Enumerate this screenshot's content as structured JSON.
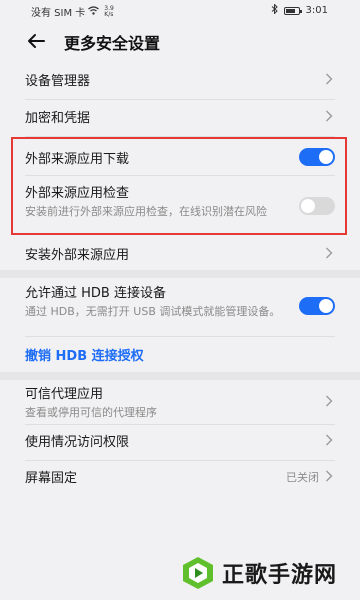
{
  "status_bar": {
    "carrier": "没有 SIM 卡",
    "net_speed_value": "3.9",
    "net_speed_unit": "K/s",
    "time": "3:01",
    "icons": [
      "wifi-icon",
      "bluetooth-icon",
      "battery-icon"
    ]
  },
  "header": {
    "title": "更多安全设置"
  },
  "items": {
    "device_admin": {
      "label": "设备管理器"
    },
    "encryption": {
      "label": "加密和凭据"
    },
    "ext_download": {
      "label": "外部来源应用下载",
      "enabled": true
    },
    "ext_check": {
      "label": "外部来源应用检查",
      "desc": "安装前进行外部来源应用检查，在线识别潜在风险",
      "enabled": false
    },
    "install_ext": {
      "label": "安装外部来源应用"
    },
    "hdb": {
      "label": "允许通过 HDB 连接设备",
      "desc": "通过 HDB，无需打开 USB 调试模式就能管理设备。",
      "enabled": true
    },
    "revoke_hdb": {
      "label": "撤销 HDB 连接授权"
    },
    "trust_agent": {
      "label": "可信代理应用",
      "desc": "查看或停用可信的代理程序"
    },
    "usage_access": {
      "label": "使用情况访问权限"
    },
    "screen_pin": {
      "label": "屏幕固定",
      "value": "已关闭"
    }
  },
  "watermark": {
    "text": "正歌手游网"
  },
  "colors": {
    "accent": "#1e6df6",
    "highlight_border": "#e53935",
    "background": "#f1f1f3"
  }
}
